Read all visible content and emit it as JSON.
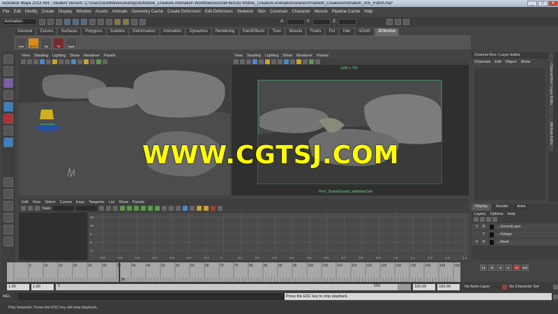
{
  "window": {
    "title": "Autodesk Maya 2013 x64 : Student Version: C:\\Users\\3DMotive\\Desktop\\3DMotive_Creature Animation Workflow\\SourceFiles\\3D Motive_Creature Animation\\scenes\\PrairieM_CreatureAnimation_v05_Polish.ma*",
    "min": "_",
    "max": "□",
    "close": "✕"
  },
  "menubar": [
    "File",
    "Edit",
    "Modify",
    "Create",
    "Display",
    "Window",
    "Assets",
    "Animate",
    "Geometry Cache",
    "Create Deformers",
    "Edit Deformers",
    "Skeleton",
    "Skin",
    "Constrain",
    "Character",
    "Muscle",
    "Pipeline Cache",
    "Help"
  ],
  "status": {
    "mode": "Animation",
    "x_label": "X:",
    "y_label": "Y:",
    "z_label": "Z:"
  },
  "shelf_tabs": [
    "General",
    "Curves",
    "Surfaces",
    "Polygons",
    "Subdivs",
    "Deformation",
    "Animation",
    "Dynamics",
    "Rendering",
    "PaintEffects",
    "Toon",
    "Muscle",
    "Fluids",
    "Fur",
    "Hair",
    "nCloth",
    "3DMotive"
  ],
  "shelf_active": "3DMotive",
  "shelf_buttons": [
    "Outl",
    "AUTO",
    "Tail",
    "Rt",
    "Rapit"
  ],
  "viewport_menu": [
    "View",
    "Shading",
    "Lighting",
    "Show",
    "Renderer",
    "Panels"
  ],
  "viewport2": {
    "resolution": "1280 x 720",
    "camera": "Prior_SnakeGround_withMainCam"
  },
  "channel_box": {
    "title": "Channel Box / Layer Editor",
    "menu": [
      "Channels",
      "Edit",
      "Object",
      "Show"
    ]
  },
  "side_tabs": [
    "Channel Box / Layer Editor",
    "Attribute Editor"
  ],
  "layer_tabs": [
    "Display",
    "Render",
    "Anim"
  ],
  "layer_menu": [
    "Layers",
    "Options",
    "Help"
  ],
  "layers": [
    {
      "v": "V",
      "r": "R",
      "name": "...:GroundLayer"
    },
    {
      "v": "",
      "r": "T",
      "name": "...:Foliage"
    },
    {
      "v": "V",
      "r": "R",
      "name": "...:Mesh"
    }
  ],
  "graph_menu": [
    "Edit",
    "View",
    "Select",
    "Curves",
    "Keys",
    "Tangents",
    "List",
    "Show",
    "Panels"
  ],
  "graph_stats": "Stats",
  "graph_ticks": [
    "-0.8",
    "-0.6",
    "-0.5",
    "-0.4",
    "-0.3",
    "-0.2",
    "-0.1",
    "0",
    "0.1",
    "0.2",
    "0.3",
    "0.4",
    "0.5",
    "0.6",
    "0.7",
    "0.8",
    "0.9",
    "1.0",
    "1.1",
    "1.2",
    "1.3",
    "1.4"
  ],
  "graph_vticks": [
    "15",
    "10",
    "5",
    "0",
    "-5"
  ],
  "timeline_ticks": [
    "5",
    "10",
    "15",
    "20",
    "25",
    "30",
    "35",
    "40",
    "45",
    "50",
    "55",
    "60",
    "65",
    "70",
    "75",
    "80",
    "85",
    "90",
    "95",
    "100",
    "105",
    "110",
    "115",
    "120",
    "125",
    "130",
    "135",
    "140",
    "145",
    "150"
  ],
  "current_frame": "36",
  "range": {
    "start": "1.00",
    "start2": "1.00",
    "range_start": "1",
    "range_end": "150",
    "end": "150.00",
    "end2": "150.00",
    "anim_layer": "No Anim Layer",
    "character": "No Character Set"
  },
  "playback": [
    "|◂",
    "◂|",
    "◂",
    "▸",
    "▸|",
    "▸▸|"
  ],
  "cmd": {
    "label": "MEL",
    "result": "Press the ESC key to stop playback."
  },
  "help": "Play forwards. Press the ESC key will stop playback.",
  "watermark": "WWW.CGTSJ.COM"
}
